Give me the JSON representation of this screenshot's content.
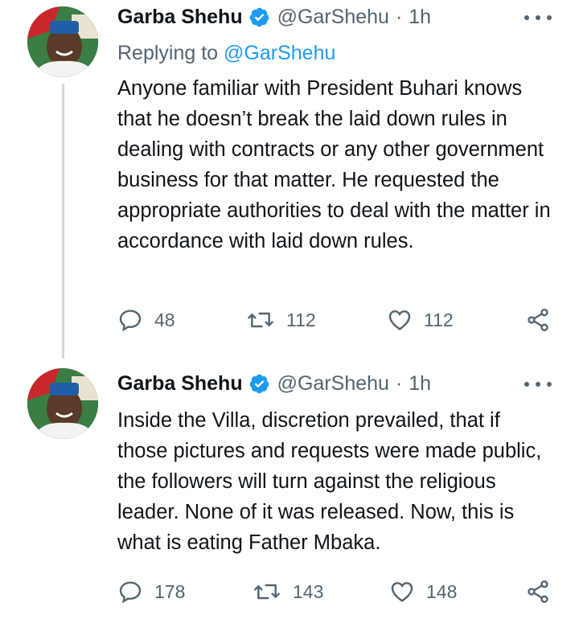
{
  "tweets": [
    {
      "name": "Garba Shehu",
      "handle": "@GarShehu",
      "separator": "·",
      "time": "1h",
      "replying_prefix": "Replying to ",
      "replying_to": "@GarShehu",
      "text": "Anyone familiar with President Buhari knows that he doesn’t break the laid down rules in dealing with contracts or any other government business for that matter. He requested the appropriate authorities to deal with the matter in accordance with laid down rules.",
      "replies": "48",
      "retweets": "112",
      "likes": "112"
    },
    {
      "name": "Garba Shehu",
      "handle": "@GarShehu",
      "separator": "·",
      "time": "1h",
      "text": "Inside the Villa, discretion prevailed, that if those pictures and requests were made public, the followers will turn against the religious leader. None of it was released. Now, this is what is eating Father Mbaka.",
      "replies": "178",
      "retweets": "143",
      "likes": "148"
    }
  ],
  "colors": {
    "accent": "#1d9bf0",
    "secondary": "#536471",
    "thread_line": "#cfd9de"
  },
  "icons": [
    "avatar",
    "verified-badge-icon",
    "more-icon",
    "reply-icon",
    "retweet-icon",
    "like-icon",
    "share-icon"
  ]
}
